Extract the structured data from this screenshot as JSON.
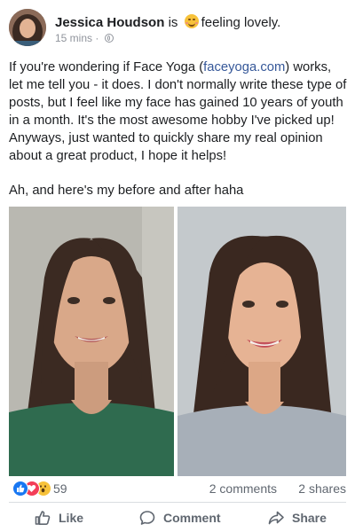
{
  "post": {
    "author": "Jessica Houdson",
    "is_word": "is",
    "feeling": "feeling lovely.",
    "timestamp": "15 mins",
    "separator": "·",
    "text_before_link": "If you're wondering if Face Yoga (",
    "link_text": "faceyoga.com",
    "text_after_link": ") works, let me tell you - it does. I don't normally write these type of posts, but I feel like my face has gained 10 years of youth in a month. It's the most awesome hobby I've picked up! Anyways, just wanted to quickly share my real opinion about a great product, I hope it helps!",
    "followup": "Ah, and here's my before and after haha"
  },
  "stats": {
    "reaction_count": "59",
    "comments": "2 comments",
    "shares": "2 shares"
  },
  "actions": {
    "like": "Like",
    "comment": "Comment",
    "share": "Share"
  },
  "icons": {
    "feeling": "smiling-blush-emoji-icon",
    "privacy": "globe-icon",
    "reactions": [
      "like-reaction-icon",
      "love-reaction-icon",
      "wow-reaction-icon"
    ],
    "actions": [
      "thumbs-up-icon",
      "speech-bubble-icon",
      "share-arrow-icon"
    ]
  },
  "colors": {
    "link": "#365899",
    "muted": "#90949c",
    "action": "#606770",
    "like_blue": "#1877f2",
    "love_red": "#f33e58",
    "wow_yellow": "#f7c23a"
  }
}
